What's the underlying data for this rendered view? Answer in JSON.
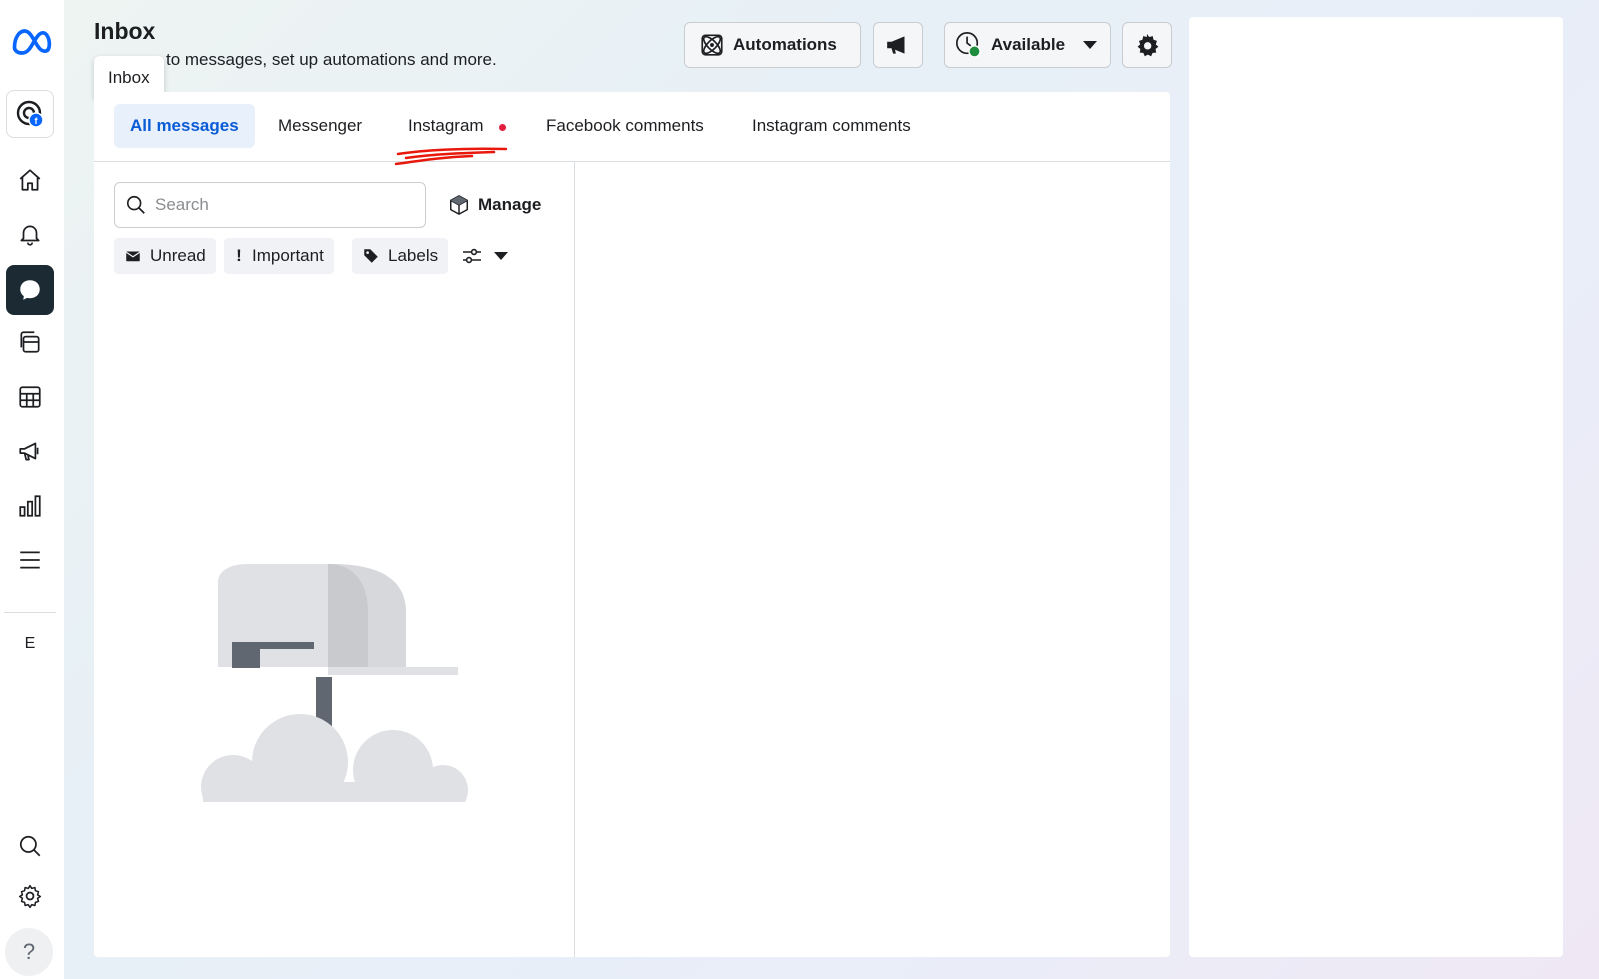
{
  "header": {
    "title": "Inbox",
    "subtitle": "to messages, set up automations and more.",
    "tooltip": "Inbox",
    "automations_label": "Automations",
    "availability_label": "Available"
  },
  "sidebar": {
    "letter": "E",
    "help": "?"
  },
  "tabs": [
    {
      "label": "All messages",
      "active": true
    },
    {
      "label": "Messenger",
      "active": false
    },
    {
      "label": "Instagram",
      "active": false,
      "has_notification": true
    },
    {
      "label": "Facebook comments",
      "active": false
    },
    {
      "label": "Instagram comments",
      "active": false
    }
  ],
  "list": {
    "search_placeholder": "Search",
    "manage_label": "Manage",
    "filters": [
      {
        "label": "Unread",
        "icon": "envelope-icon"
      },
      {
        "label": "Important",
        "icon": "exclamation-icon"
      },
      {
        "label": "Labels",
        "icon": "tag-icon"
      }
    ]
  },
  "colors": {
    "active_tab_bg": "#e7f0fb",
    "active_tab_text": "#0a5bd6",
    "status_available": "#1e8e3e",
    "notification_dot": "#e41e3f",
    "sidebar_active": "#1c2b33"
  }
}
